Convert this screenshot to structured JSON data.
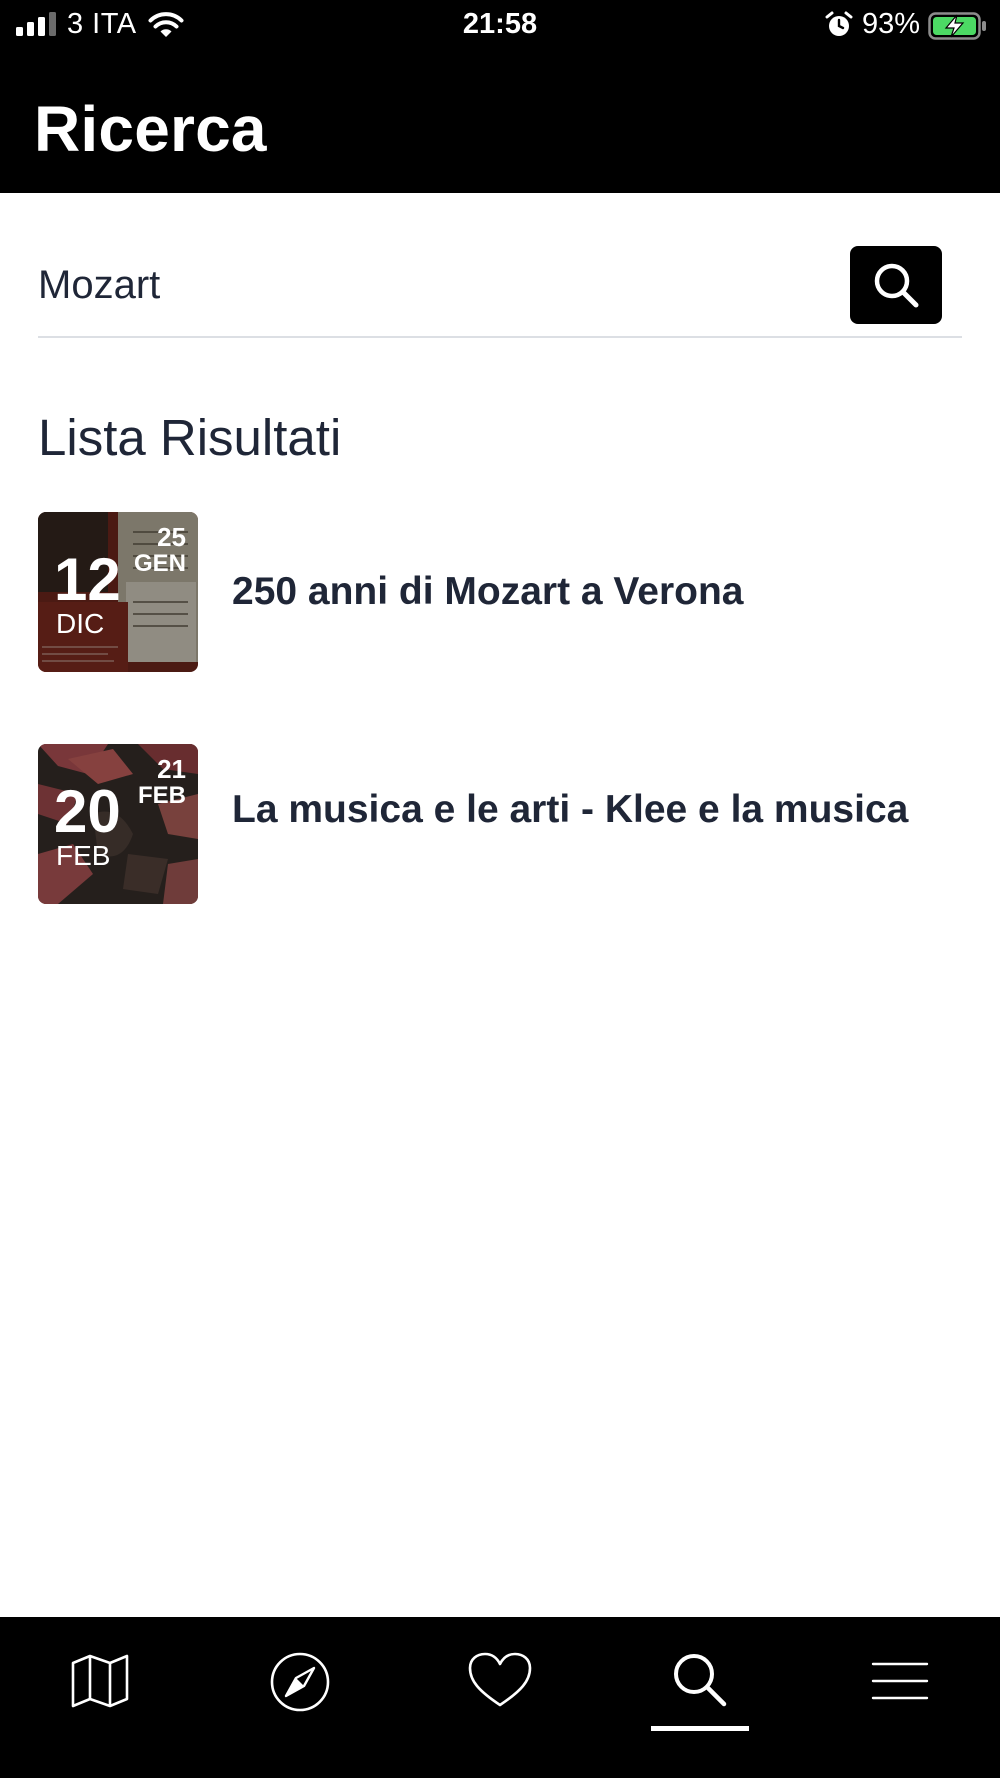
{
  "status_bar": {
    "carrier": "3 ITA",
    "time": "21:58",
    "battery": "93%",
    "icons": [
      "signal-icon",
      "wifi-icon",
      "alarm-icon",
      "battery-charging-icon"
    ]
  },
  "header": {
    "title": "Ricerca"
  },
  "search": {
    "value": "Mozart",
    "placeholder": "",
    "button_icon": "search-icon"
  },
  "results": {
    "heading": "Lista Risultati",
    "items": [
      {
        "title": "250 anni di Mozart a Verona",
        "start_day": "12",
        "start_month": "DIC",
        "end_day": "25",
        "end_month": "GEN"
      },
      {
        "title": "La musica e le arti - Klee e la musica",
        "start_day": "20",
        "start_month": "FEB",
        "end_day": "21",
        "end_month": "FEB"
      }
    ]
  },
  "tabbar": {
    "tabs": [
      {
        "icon": "map-icon",
        "active": false
      },
      {
        "icon": "compass-icon",
        "active": false
      },
      {
        "icon": "heart-icon",
        "active": false
      },
      {
        "icon": "search-icon",
        "active": true
      },
      {
        "icon": "menu-icon",
        "active": false
      }
    ]
  },
  "colors": {
    "header_bg": "#000000",
    "text_dark": "#1f2637",
    "divider": "#dcdfe4",
    "battery_green": "#4cd964"
  }
}
